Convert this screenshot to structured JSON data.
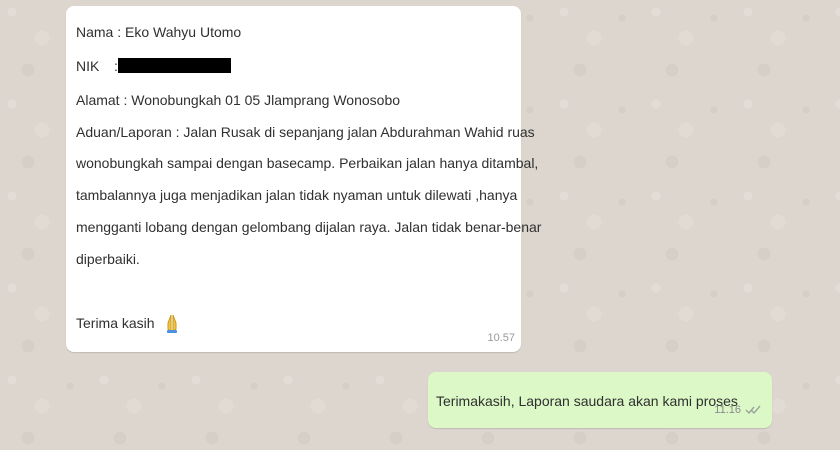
{
  "chat": {
    "incoming_message": {
      "name_line": "Nama : Eko Wahyu Utomo",
      "nik_label": "NIK",
      "nik_separator": ":",
      "address_line": "Alamat : Wonobungkah 01 05 Jlamprang Wonosobo",
      "complaint_line_1": "Aduan/Laporan : Jalan Rusak  di sepanjang jalan Abdurahman Wahid ruas",
      "complaint_line_2": "wonobungkah sampai dengan basecamp. Perbaikan jalan hanya ditambal,",
      "complaint_line_3": "tambalannya juga menjadikan jalan tidak nyaman untuk dilewati ,hanya",
      "complaint_line_4": "mengganti lobang dengan gelombang dijalan raya. Jalan tidak benar-benar",
      "complaint_line_5": "diperbaiki.",
      "closing_text": "Terima kasih",
      "emoji_icon": "folded-hands-icon",
      "time": "10.57"
    },
    "outgoing_message": {
      "text": "Terimakasih, Laporan saudara akan kami proses",
      "time": "11.16",
      "status_icon": "double-check-icon"
    }
  },
  "colors": {
    "chat_background": "#ddd6ce",
    "incoming_bubble": "#ffffff",
    "outgoing_bubble": "#dcf8c6",
    "message_text": "#303030",
    "timestamp_text": "#9a9a9a"
  }
}
